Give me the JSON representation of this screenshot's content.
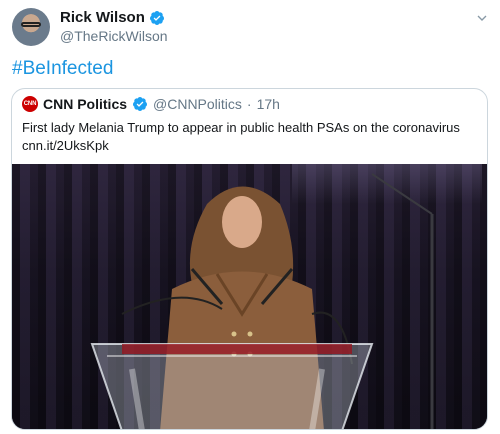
{
  "author": {
    "name": "Rick Wilson",
    "handle": "@TheRickWilson",
    "verified": true
  },
  "tweet": {
    "hashtag": "#BeInfected"
  },
  "quoted": {
    "logo_text": "CNN",
    "name": "CNN Politics",
    "handle": "@CNNPolitics",
    "separator": "·",
    "time": "17h",
    "text": "First lady Melania Trump to appear in public health PSAs on the coronavirus",
    "link": "cnn.it/2UksKpk"
  },
  "colors": {
    "link": "#1b95e0",
    "verified": "#1da1f2",
    "cnn_red": "#cc0000",
    "secondary_text": "#657786"
  },
  "icons": {
    "verified": "verified-badge-icon",
    "menu": "chevron-down-icon"
  }
}
